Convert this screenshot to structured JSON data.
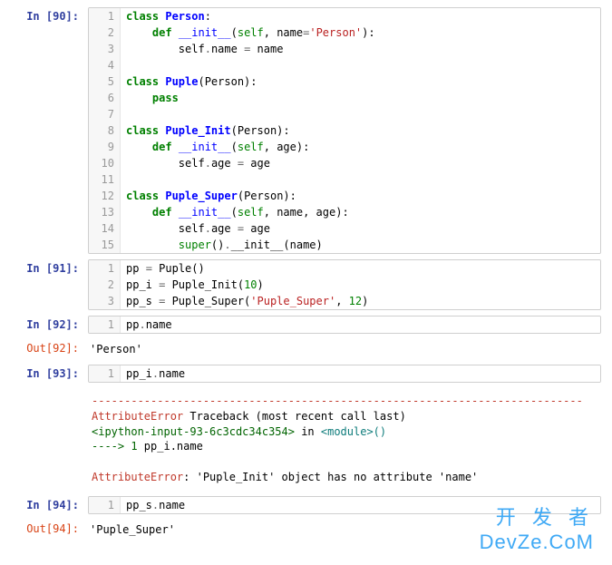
{
  "cells": [
    {
      "type": "in",
      "n": 90,
      "lines": [
        [
          {
            "t": "class ",
            "c": "kw"
          },
          {
            "t": "Person",
            "c": "cls"
          },
          {
            "t": ":",
            "c": ""
          }
        ],
        [
          {
            "t": "    ",
            "c": ""
          },
          {
            "t": "def ",
            "c": "kw"
          },
          {
            "t": "__init__",
            "c": "fn"
          },
          {
            "t": "(",
            "c": ""
          },
          {
            "t": "self",
            "c": "self"
          },
          {
            "t": ", name",
            "c": ""
          },
          {
            "t": "=",
            "c": "op"
          },
          {
            "t": "'Person'",
            "c": "str"
          },
          {
            "t": "):",
            "c": ""
          }
        ],
        [
          {
            "t": "        self",
            "c": ""
          },
          {
            "t": ".",
            "c": "op"
          },
          {
            "t": "name ",
            "c": ""
          },
          {
            "t": "=",
            "c": "op"
          },
          {
            "t": " name",
            "c": ""
          }
        ],
        [
          {
            "t": "",
            "c": ""
          }
        ],
        [
          {
            "t": "class ",
            "c": "kw"
          },
          {
            "t": "Puple",
            "c": "cls"
          },
          {
            "t": "(Person):",
            "c": ""
          }
        ],
        [
          {
            "t": "    ",
            "c": ""
          },
          {
            "t": "pass",
            "c": "kw"
          }
        ],
        [
          {
            "t": "",
            "c": ""
          }
        ],
        [
          {
            "t": "class ",
            "c": "kw"
          },
          {
            "t": "Puple_Init",
            "c": "cls"
          },
          {
            "t": "(Person):",
            "c": ""
          }
        ],
        [
          {
            "t": "    ",
            "c": ""
          },
          {
            "t": "def ",
            "c": "kw"
          },
          {
            "t": "__init__",
            "c": "fn"
          },
          {
            "t": "(",
            "c": ""
          },
          {
            "t": "self",
            "c": "self"
          },
          {
            "t": ", age):",
            "c": ""
          }
        ],
        [
          {
            "t": "        self",
            "c": ""
          },
          {
            "t": ".",
            "c": "op"
          },
          {
            "t": "age ",
            "c": ""
          },
          {
            "t": "=",
            "c": "op"
          },
          {
            "t": " age",
            "c": ""
          }
        ],
        [
          {
            "t": "",
            "c": ""
          }
        ],
        [
          {
            "t": "class ",
            "c": "kw"
          },
          {
            "t": "Puple_Super",
            "c": "cls"
          },
          {
            "t": "(Person):",
            "c": ""
          }
        ],
        [
          {
            "t": "    ",
            "c": ""
          },
          {
            "t": "def ",
            "c": "kw"
          },
          {
            "t": "__init__",
            "c": "fn"
          },
          {
            "t": "(",
            "c": ""
          },
          {
            "t": "self",
            "c": "self"
          },
          {
            "t": ", name, age):",
            "c": ""
          }
        ],
        [
          {
            "t": "        self",
            "c": ""
          },
          {
            "t": ".",
            "c": "op"
          },
          {
            "t": "age ",
            "c": ""
          },
          {
            "t": "=",
            "c": "op"
          },
          {
            "t": " age",
            "c": ""
          }
        ],
        [
          {
            "t": "        super",
            "c": "self"
          },
          {
            "t": "()",
            "c": ""
          },
          {
            "t": ".",
            "c": "op"
          },
          {
            "t": "__init__(name)",
            "c": ""
          }
        ]
      ]
    },
    {
      "type": "in",
      "n": 91,
      "lines": [
        [
          {
            "t": "pp ",
            "c": ""
          },
          {
            "t": "=",
            "c": "op"
          },
          {
            "t": " Puple()",
            "c": ""
          }
        ],
        [
          {
            "t": "pp_i ",
            "c": ""
          },
          {
            "t": "=",
            "c": "op"
          },
          {
            "t": " Puple_Init(",
            "c": ""
          },
          {
            "t": "10",
            "c": "num"
          },
          {
            "t": ")",
            "c": ""
          }
        ],
        [
          {
            "t": "pp_s ",
            "c": ""
          },
          {
            "t": "=",
            "c": "op"
          },
          {
            "t": " Puple_Super(",
            "c": ""
          },
          {
            "t": "'Puple_Super'",
            "c": "str"
          },
          {
            "t": ", ",
            "c": ""
          },
          {
            "t": "12",
            "c": "num"
          },
          {
            "t": ")",
            "c": ""
          }
        ]
      ]
    },
    {
      "type": "in",
      "n": 92,
      "lines": [
        [
          {
            "t": "pp",
            "c": ""
          },
          {
            "t": ".",
            "c": "op"
          },
          {
            "t": "name",
            "c": ""
          }
        ]
      ]
    },
    {
      "type": "out",
      "n": 92,
      "text": "'Person'"
    },
    {
      "type": "in",
      "n": 93,
      "lines": [
        [
          {
            "t": "pp_i",
            "c": ""
          },
          {
            "t": ".",
            "c": "op"
          },
          {
            "t": "name",
            "c": ""
          }
        ]
      ]
    },
    {
      "type": "traceback",
      "sep": "---------------------------------------------------------------------------",
      "err_name": "AttributeError",
      "tb_label": "Traceback (most recent call last)",
      "loc_ref": "<ipython-input-93-6c3cdc34c354>",
      "loc_in": " in ",
      "loc_mod": "<module>",
      "loc_tail": "()",
      "arrow": "----> 1",
      "arrow_code": " pp_i.name",
      "msg_name": "AttributeError",
      "msg_rest": ": 'Puple_Init' object has no attribute 'name'"
    },
    {
      "type": "in",
      "n": 94,
      "lines": [
        [
          {
            "t": "pp_s",
            "c": ""
          },
          {
            "t": ".",
            "c": "op"
          },
          {
            "t": "name",
            "c": ""
          }
        ]
      ]
    },
    {
      "type": "out",
      "n": 94,
      "text": "'Puple_Super'"
    }
  ],
  "watermark": {
    "top": "开 发 者",
    "bottom": "DevZe.CoM"
  }
}
